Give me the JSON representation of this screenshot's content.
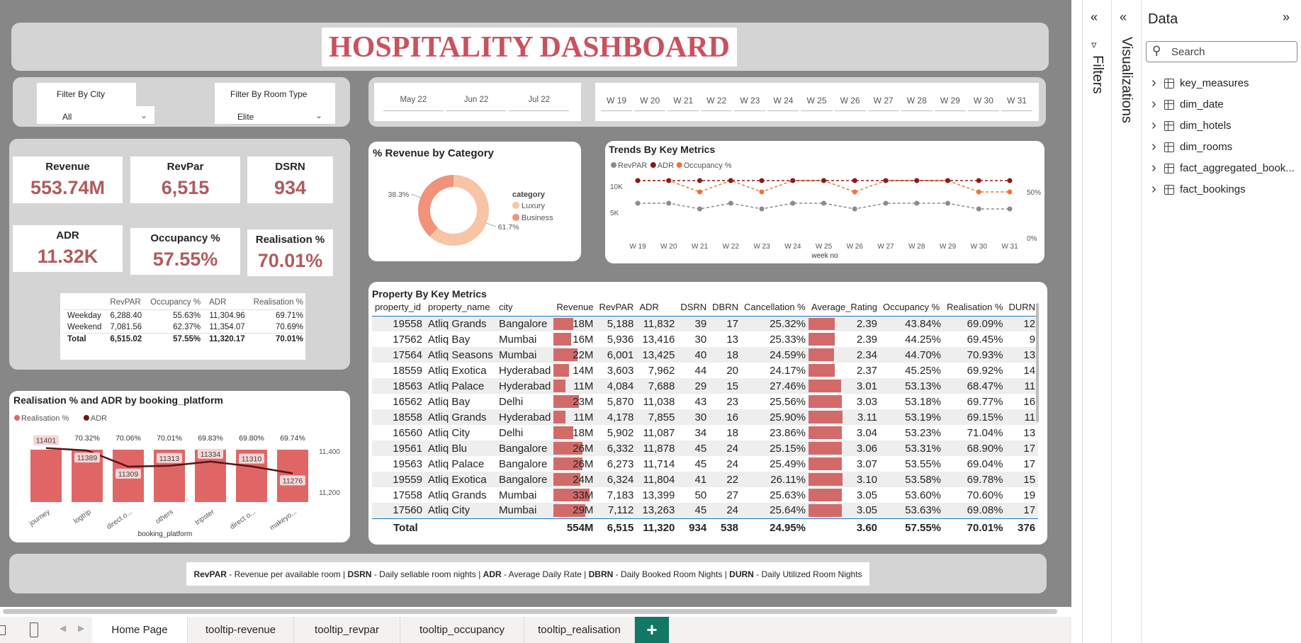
{
  "header": {
    "title": "HOSPITALITY DASHBOARD"
  },
  "filters": {
    "city": {
      "label": "Filter By City",
      "value": "All"
    },
    "room_type": {
      "label": "Filter By Room Type",
      "value": "Elite"
    }
  },
  "months": [
    "May 22",
    "Jun 22",
    "Jul 22"
  ],
  "weeks": [
    "W 19",
    "W 20",
    "W 21",
    "W 22",
    "W 23",
    "W 24",
    "W 25",
    "W 26",
    "W 27",
    "W 28",
    "W 29",
    "W 30",
    "W 31"
  ],
  "kpis": [
    {
      "label": "Revenue",
      "value": "553.74M"
    },
    {
      "label": "RevPar",
      "value": "6,515"
    },
    {
      "label": "DSRN",
      "value": "934"
    },
    {
      "label": "ADR",
      "value": "11.32K"
    },
    {
      "label": "Occupancy %",
      "value": "57.55%"
    },
    {
      "label": "Realisation %",
      "value": "70.01%"
    }
  ],
  "daytype_table": {
    "headers": [
      "",
      "RevPAR",
      "Occupancy %",
      "ADR",
      "Realisation %"
    ],
    "rows": [
      [
        "Weekday",
        "6,288.40",
        "55.63%",
        "11,304.96",
        "69.71%"
      ],
      [
        "Weekend",
        "7,081.56",
        "62.37%",
        "11,354.07",
        "70.69%"
      ],
      [
        "Total",
        "6,515.02",
        "57.55%",
        "11,320.17",
        "70.01%"
      ]
    ]
  },
  "revenue_by_category": {
    "title": "% Revenue by Category",
    "legend_title": "category",
    "slices": [
      {
        "name": "Luxury",
        "percent": 61.7,
        "label": "61.7%",
        "color": "#f7c4a5"
      },
      {
        "name": "Business",
        "percent": 38.3,
        "label": "38.3%",
        "color": "#f0937a"
      }
    ]
  },
  "trends": {
    "title": "Trends By Key Metrics",
    "legend": [
      {
        "name": "RevPAR",
        "color": "#8c8c8c"
      },
      {
        "name": "ADR",
        "color": "#8b1a1a"
      },
      {
        "name": "Occupancy %",
        "color": "#e8763a"
      }
    ],
    "y_ticks": [
      "10K",
      "5K"
    ],
    "y2_ticks": [
      "50%",
      "0%"
    ],
    "xlabel": "week no",
    "revpar": [
      6500,
      6600,
      5900,
      6700,
      5900,
      6500,
      6400,
      5700,
      6500,
      6500,
      6400,
      5900,
      5800
    ],
    "adr": [
      11300,
      11300,
      11300,
      11300,
      11300,
      11300,
      11300,
      11300,
      11300,
      11300,
      11300,
      11300,
      11300
    ],
    "occupancy": [
      58,
      58,
      51,
      58,
      51,
      58,
      58,
      51,
      58,
      58,
      58,
      52,
      51
    ]
  },
  "platform_chart": {
    "title": "Realisation % and ADR by booking_platform",
    "legend": [
      {
        "name": "Realisation %",
        "color": "#e06666"
      },
      {
        "name": "ADR",
        "color": "#6b1a1a"
      }
    ],
    "categories": [
      "journey",
      "logtrip",
      "direct o...",
      "others",
      "tripster",
      "direct o...",
      "makeyo..."
    ],
    "realisation": [
      70.66,
      70.32,
      70.06,
      70.01,
      69.83,
      69.8,
      69.74
    ],
    "realisation_labels": [
      "70.66%",
      "70.32%",
      "70.06%",
      "70.01%",
      "69.83%",
      "69.80%",
      "69.74%"
    ],
    "adr": [
      11401,
      11389,
      11309,
      11313,
      11334,
      11310,
      11276
    ],
    "adr_labels": [
      "11401",
      "11389",
      "11309",
      "11313",
      "11334",
      "11310",
      "11276"
    ],
    "y2_ticks": [
      "11,400",
      "11,200"
    ],
    "xlabel": "booking_platform"
  },
  "property_table": {
    "title": "Property By Key Metrics",
    "headers": [
      "property_id",
      "property_name",
      "city",
      "Revenue",
      "RevPAR",
      "ADR",
      "DSRN",
      "DBRN",
      "Cancellation %",
      "Average_Rating",
      "Occupancy %",
      "Realisation %",
      "DURN"
    ],
    "rows": [
      [
        "19558",
        "Atliq Grands",
        "Bangalore",
        "18M",
        "5,188",
        "11,832",
        "39",
        "17",
        "25.32%",
        "2.39",
        "43.84%",
        "69.09%",
        "12"
      ],
      [
        "17562",
        "Atliq Bay",
        "Mumbai",
        "16M",
        "5,936",
        "13,416",
        "30",
        "13",
        "25.33%",
        "2.39",
        "44.25%",
        "69.45%",
        "9"
      ],
      [
        "17564",
        "Atliq Seasons",
        "Mumbai",
        "22M",
        "6,001",
        "13,425",
        "40",
        "18",
        "24.59%",
        "2.34",
        "44.70%",
        "70.93%",
        "13"
      ],
      [
        "18559",
        "Atliq Exotica",
        "Hyderabad",
        "14M",
        "3,603",
        "7,962",
        "44",
        "20",
        "24.17%",
        "2.37",
        "45.25%",
        "69.92%",
        "14"
      ],
      [
        "18563",
        "Atliq Palace",
        "Hyderabad",
        "11M",
        "4,084",
        "7,688",
        "29",
        "15",
        "27.46%",
        "3.01",
        "53.13%",
        "68.47%",
        "11"
      ],
      [
        "16562",
        "Atliq Bay",
        "Delhi",
        "23M",
        "5,870",
        "11,038",
        "43",
        "23",
        "25.56%",
        "3.03",
        "53.18%",
        "69.77%",
        "16"
      ],
      [
        "18558",
        "Atliq Grands",
        "Hyderabad",
        "11M",
        "4,178",
        "7,855",
        "30",
        "16",
        "25.90%",
        "3.11",
        "53.19%",
        "69.15%",
        "11"
      ],
      [
        "16560",
        "Atliq City",
        "Delhi",
        "18M",
        "5,902",
        "11,087",
        "34",
        "18",
        "23.86%",
        "3.04",
        "53.23%",
        "71.04%",
        "13"
      ],
      [
        "19561",
        "Atliq Blu",
        "Bangalore",
        "26M",
        "6,332",
        "11,878",
        "45",
        "24",
        "25.15%",
        "3.06",
        "53.31%",
        "68.90%",
        "17"
      ],
      [
        "19563",
        "Atliq Palace",
        "Bangalore",
        "26M",
        "6,273",
        "11,714",
        "45",
        "24",
        "25.49%",
        "3.07",
        "53.55%",
        "69.04%",
        "17"
      ],
      [
        "19559",
        "Atliq Exotica",
        "Bangalore",
        "24M",
        "6,324",
        "11,804",
        "41",
        "22",
        "26.11%",
        "3.10",
        "53.58%",
        "69.78%",
        "15"
      ],
      [
        "17558",
        "Atliq Grands",
        "Mumbai",
        "33M",
        "7,183",
        "13,399",
        "50",
        "27",
        "25.63%",
        "3.05",
        "53.60%",
        "70.60%",
        "19"
      ],
      [
        "17560",
        "Atliq City",
        "Mumbai",
        "29M",
        "7,112",
        "13,263",
        "45",
        "24",
        "25.64%",
        "3.05",
        "53.63%",
        "69.08%",
        "17"
      ]
    ],
    "revenue_values": [
      18,
      16,
      22,
      14,
      11,
      23,
      11,
      18,
      26,
      26,
      24,
      33,
      29
    ],
    "rating_values": [
      2.39,
      2.39,
      2.34,
      2.37,
      3.01,
      3.03,
      3.11,
      3.04,
      3.06,
      3.07,
      3.1,
      3.05,
      3.05
    ],
    "total": [
      "Total",
      "",
      "",
      "554M",
      "6,515",
      "11,320",
      "934",
      "538",
      "24.95%",
      "3.60",
      "57.55%",
      "70.01%",
      "376"
    ]
  },
  "footer_note": [
    {
      "b": "RevPAR",
      "t": " - Revenue per available room | "
    },
    {
      "b": "DSRN",
      "t": " - Daily sellable room nights | "
    },
    {
      "b": "ADR",
      "t": " - Average Daily Rate | "
    },
    {
      "b": "DBRN",
      "t": " - Daily Booked Room Nights | "
    },
    {
      "b": "DURN",
      "t": " - Daily Utilized Room Nights"
    }
  ],
  "tabs": [
    "Home Page",
    "tooltip-revenue",
    "tooltip_revpar",
    "tooltip_occupancy",
    "tooltip_realisation"
  ],
  "panes": {
    "filters": "Filters",
    "visualizations": "Visualizations",
    "data_title": "Data",
    "search_placeholder": "Search",
    "fields": [
      "key_measures",
      "dim_date",
      "dim_hotels",
      "dim_rooms",
      "fact_aggregated_book...",
      "fact_bookings"
    ]
  },
  "colors": {
    "accent": "#c9525f",
    "kpi": "#b05b5d",
    "bar": "#d26a6a",
    "tab_add": "#117865"
  }
}
